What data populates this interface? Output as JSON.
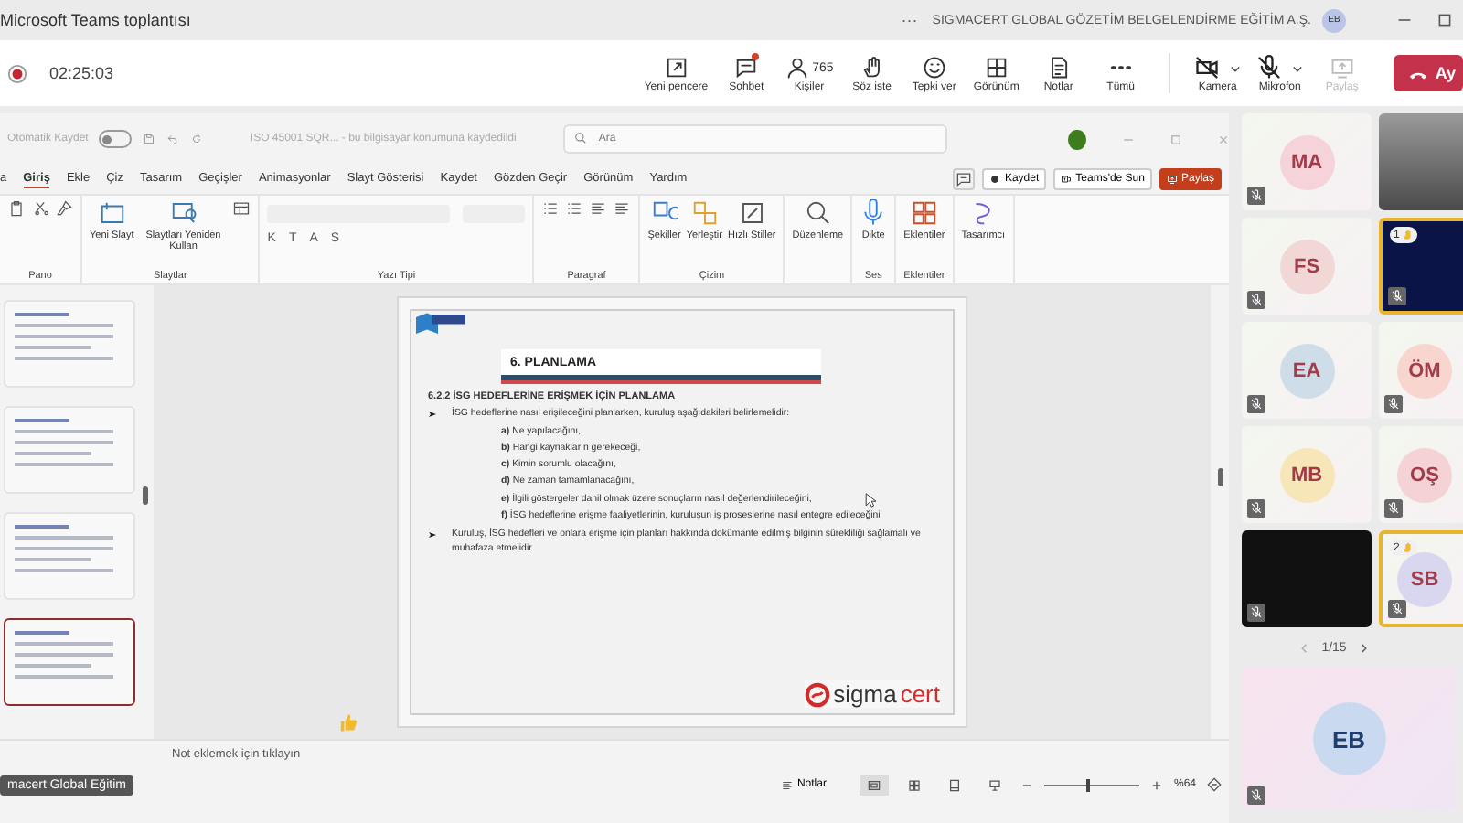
{
  "window": {
    "title": "Microsoft Teams toplantısı",
    "more": "···",
    "organization": "SIGMACERT GLOBAL GÖZETİM BELGELENDİRME EĞİTİM A.Ş.",
    "user_initials": "EB"
  },
  "meeting_bar": {
    "recording": true,
    "elapsed": "02:25:03",
    "buttons": [
      {
        "kind": "window",
        "label": "Yeni pencere",
        "notification": false
      },
      {
        "kind": "chat",
        "label": "Sohbet",
        "notification": true
      },
      {
        "kind": "people",
        "label": "Kişiler",
        "count": "765",
        "notification": false
      },
      {
        "kind": "hand",
        "label": "Söz iste",
        "notification": false
      },
      {
        "kind": "emoji",
        "label": "Tepki ver",
        "notification": false
      },
      {
        "kind": "grid",
        "label": "Görünüm",
        "notification": false
      },
      {
        "kind": "notes",
        "label": "Notlar",
        "notification": false
      },
      {
        "kind": "more",
        "label": "Tümü",
        "notification": false
      }
    ],
    "devices": [
      {
        "kind": "camera",
        "label": "Kamera",
        "off": true
      },
      {
        "kind": "mic",
        "label": "Mikrofon",
        "off": true
      }
    ],
    "share": {
      "label": "Paylaş",
      "disabled": true
    },
    "leave": {
      "label": "Ay"
    }
  },
  "ppt": {
    "autosave": {
      "label": "Otomatik Kaydet",
      "on": false
    },
    "file_title": "ISO 45001 SQR... - bu bilgisayar konumuna kaydedildi",
    "search": {
      "placeholder": "Ara"
    },
    "tabs": [
      {
        "label": "a",
        "selected": false
      },
      {
        "label": "Giriş",
        "selected": true
      },
      {
        "label": "Ekle",
        "selected": false
      },
      {
        "label": "Çiz",
        "selected": false
      },
      {
        "label": "Tasarım",
        "selected": false
      },
      {
        "label": "Geçişler",
        "selected": false
      },
      {
        "label": "Animasyonlar",
        "selected": false
      },
      {
        "label": "Slayt Gösterisi",
        "selected": false
      },
      {
        "label": "Kaydet",
        "selected": false
      },
      {
        "label": "Gözden Geçir",
        "selected": false
      },
      {
        "label": "Görünüm",
        "selected": false
      },
      {
        "label": "Yardım",
        "selected": false
      }
    ],
    "actions": [
      {
        "kind": "record",
        "label": "Kaydet"
      },
      {
        "kind": "teams",
        "label": "Teams'de Sun"
      },
      {
        "kind": "share",
        "label": "Paylaş"
      }
    ],
    "ribbon": [
      {
        "label": "Pano",
        "tools": [
          {
            "kind": "paste"
          },
          {
            "kind": "cut"
          },
          {
            "kind": "brush"
          }
        ]
      },
      {
        "label": "Slaytlar",
        "tools": [
          {
            "kind": "newslide",
            "label": "Yeni Slayt"
          },
          {
            "kind": "reuse",
            "label": "Slaytları Yeniden Kullan"
          },
          {
            "kind": "layout"
          }
        ]
      },
      {
        "label": "Yazı Tipi",
        "font_buttons": [
          "K",
          "T",
          "A",
          "S"
        ]
      },
      {
        "label": "Paragraf",
        "tools": [
          {
            "kind": "list"
          },
          {
            "kind": "list"
          },
          {
            "kind": "align"
          },
          {
            "kind": "align"
          }
        ]
      },
      {
        "label": "Çizim",
        "tools": [
          {
            "kind": "shapes",
            "label": "Şekiller"
          },
          {
            "kind": "arrange",
            "label": "Yerleştir"
          },
          {
            "kind": "styles",
            "label": "Hızlı Stiller"
          }
        ]
      },
      {
        "tools": [
          {
            "kind": "find",
            "label": "Düzenleme"
          }
        ]
      },
      {
        "label": "Ses",
        "tools": [
          {
            "kind": "dictate",
            "label": "Dikte"
          }
        ]
      },
      {
        "label": "Eklentiler",
        "tools": [
          {
            "kind": "addins",
            "label": "Eklentiler"
          }
        ]
      },
      {
        "tools": [
          {
            "kind": "designer",
            "label": "Tasarımcı"
          }
        ]
      }
    ],
    "thumbnails": [
      {
        "selected": false
      },
      {
        "selected": false
      },
      {
        "selected": false
      },
      {
        "selected": true
      }
    ],
    "slide": {
      "heading": "6. PLANLAMA",
      "subheading": "6.2.2 İSG HEDEFLERİNE ERİŞMEK İÇİN PLANLAMA",
      "bullets": [
        {
          "text": "İSG hedeflerine nasıl erişileceğini planlarken, kuruluş aşağıdakileri belirlemelidir:",
          "items": [
            "**a)** Ne yapılacağını,",
            "**b)** Hangi kaynakların gerekeceği,",
            "**c)** Kimin sorumlu olacağını,",
            "**d)** Ne zaman tamamlanacağını,",
            "**e)** İlgili göstergeler dahil olmak üzere sonuçların nasıl değerlendirileceğini,",
            "**f)** İSG hedeflerine erişme faaliyetlerinin, kuruluşun iş proseslerine nasıl entegre edileceğini"
          ]
        },
        {
          "text": "Kuruluş, İSG hedefleri ve onlara erişme için planları hakkında dokümante edilmiş bilginin sürekliliği sağlamalı ve muhafaza etmelidir."
        }
      ],
      "logo": {
        "part_1": "sigma",
        "part_2": "cert"
      }
    },
    "notes_placeholder": "Not eklemek için tıklayın",
    "presenter_tag": "macert Global Eğitim",
    "status": {
      "notes": "Notlar",
      "views": [
        {
          "kind": "normal",
          "selected": true
        },
        {
          "kind": "sorter",
          "selected": false
        },
        {
          "kind": "reading",
          "selected": false
        },
        {
          "kind": "show",
          "selected": false
        }
      ],
      "zoom": {
        "level": 0.45,
        "reading": "%64"
      }
    }
  },
  "participants": {
    "tiles": [
      {
        "kind": "initials",
        "initials": "MA",
        "color": "#f6d3d8",
        "highlighted": false
      },
      {
        "kind": "video",
        "highlighted": false
      },
      {
        "kind": "initials",
        "initials": "FS",
        "color": "#f1d8d6",
        "highlighted": false
      },
      {
        "kind": "dark",
        "hand": "1",
        "highlighted": true
      },
      {
        "kind": "initials",
        "initials": "EA",
        "color": "#cfdde8",
        "highlighted": false
      },
      {
        "kind": "initials",
        "initials": "ÖM",
        "color": "#f8d6cf",
        "highlighted": false
      },
      {
        "kind": "initials",
        "initials": "MB",
        "color": "#f7e6b8",
        "highlighted": false
      },
      {
        "kind": "initials",
        "initials": "OŞ",
        "color": "#f5d2d4",
        "highlighted": false
      },
      {
        "kind": "blank",
        "highlighted": false
      },
      {
        "kind": "initials",
        "initials": "SB",
        "hand": "2",
        "color": "#d9d6ef",
        "highlighted": true
      }
    ],
    "pager": "1/15",
    "featured": {
      "initials": "EB",
      "color": "#c9d9ef"
    }
  }
}
